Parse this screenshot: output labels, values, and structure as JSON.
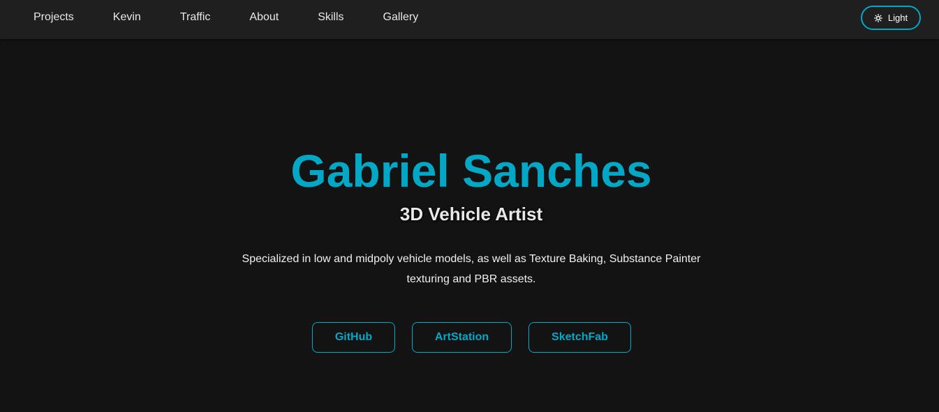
{
  "nav": {
    "links": [
      "Projects",
      "Kevin",
      "Traffic",
      "About",
      "Skills",
      "Gallery"
    ],
    "theme_toggle": {
      "label": "Light",
      "icon": "sun-icon"
    }
  },
  "hero": {
    "name": "Gabriel Sanches",
    "role": "3D Vehicle Artist",
    "description": "Specialized in low and midpoly vehicle models, as well as Texture Baking, Substance Painter texturing and PBR assets.",
    "buttons": [
      "GitHub",
      "ArtStation",
      "SketchFab"
    ]
  },
  "colors": {
    "accent": "#00a8c6",
    "background": "#131313",
    "navbar": "#1f1f1f",
    "text": "#e8e8e8"
  }
}
